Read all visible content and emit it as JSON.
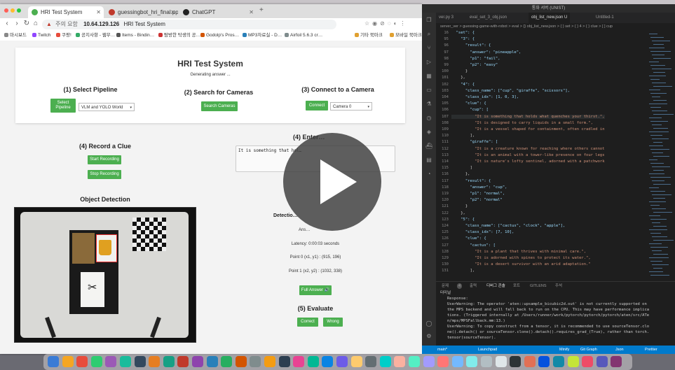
{
  "browser": {
    "tabs": [
      {
        "label": "HRI Test System",
        "color": "#4caf50"
      },
      {
        "label": "guessingbot_hri_final.pptx",
        "color": "#c0392b"
      },
      {
        "label": "ChatGPT",
        "color": "#222222"
      }
    ],
    "address": {
      "warn": "주의 요함",
      "url": "10.64.129.126",
      "page_title": "HRI Test System"
    },
    "bookmarks": [
      "마시보드",
      "Twitch",
      "쿠팡!",
      "공지사항 - 웹무…",
      "Items - Bindin…",
      "탐방한 탁생의 공…",
      "Godolp's Pros…",
      "MP3자료실 - D…",
      "Airfoil 5.6.3 cr…",
      "기타 북마크",
      "모바일 북마크"
    ]
  },
  "app": {
    "title": "HRI Test System",
    "status": "Generating answer ...",
    "pipeline": {
      "heading": "(1) Select Pipeline",
      "button": "Select Pipeline",
      "selected": "VLM and YOLO World"
    },
    "search": {
      "heading": "(2) Search for Cameras",
      "button": "Search Cameras"
    },
    "connect": {
      "heading": "(3) Connect to a Camera",
      "button": "Connect",
      "selected": "Camera 0"
    },
    "record": {
      "heading": "(4) Record a Clue",
      "start": "Start Recording",
      "stop": "Stop Recording"
    },
    "enter": {
      "heading": "(4) Enter…",
      "clue_text": "It is something that hol…"
    },
    "detection": {
      "heading": "Object Detection",
      "results_heading": "Detectio…",
      "answer_line": "Ans…",
      "latency": "Latency: 0:00:03 seconds",
      "point0": "Point 0 (x1, y1) : (915, 196)",
      "point1": "Point 1 (x2, y2) : (1032, 338)"
    },
    "full_answer": "Full Answer 🔊",
    "evaluate": {
      "heading": "(5) Evaluate",
      "correct": "Correct",
      "wrong": "Wrong"
    }
  },
  "vscode": {
    "title": "통화 서버 (UNIST)",
    "tabs": [
      "ver.py 3",
      "eval_set_3_obj.json",
      "obj_list_new.json U",
      "Untitled-1"
    ],
    "breadcrumb": "server_ver > guessing-game-with-robot > eval > {} obj_list_new.json > { } set > { } 4 > { } clue > [ ] cup",
    "lines": [
      {
        "n": "16",
        "t": "  \"set\": {"
      },
      {
        "n": "95",
        "t": "    \"3\": {"
      },
      {
        "n": "96",
        "t": "      \"result\": {"
      },
      {
        "n": "97",
        "t": "        \"answer\": \"pineapple\","
      },
      {
        "n": "98",
        "t": "        \"p1\": \"fail\","
      },
      {
        "n": "99",
        "t": "        \"p2\": \"easy\""
      },
      {
        "n": "100",
        "t": "      }"
      },
      {
        "n": "101",
        "t": "    },"
      },
      {
        "n": "102",
        "t": "    \"4\": {"
      },
      {
        "n": "103",
        "t": "      \"class_name\": [\"cup\", \"giraffe\", \"scissors\"],"
      },
      {
        "n": "104",
        "t": "      \"class_idx\": [1, 0, 3],"
      },
      {
        "n": "105",
        "t": "      \"clue\": {"
      },
      {
        "n": "106",
        "t": "        \"cup\": ["
      },
      {
        "n": "107",
        "t": "          \"It is something that holds what quenches your thirst.\","
      },
      {
        "n": "108",
        "t": "          \"It is designed to carry liquids in a small form.\","
      },
      {
        "n": "109",
        "t": "          \"It is a vessel shaped for containment, often cradled in"
      },
      {
        "n": "110",
        "t": "        ],"
      },
      {
        "n": "111",
        "t": "        \"giraffe\": ["
      },
      {
        "n": "112",
        "t": "          \"It is a creature known for reaching where others cannot"
      },
      {
        "n": "113",
        "t": "          \"It is an animal with a tower-like presence on four legs"
      },
      {
        "n": "114",
        "t": "          \"It is nature's lofty sentinel, adorned with a patchwork"
      },
      {
        "n": "115",
        "t": "        ]"
      },
      {
        "n": "116",
        "t": "      },"
      },
      {
        "n": "117",
        "t": "      \"result\": {"
      },
      {
        "n": "118",
        "t": "        \"answer\": \"cup\","
      },
      {
        "n": "119",
        "t": "        \"p1\": \"normal\","
      },
      {
        "n": "120",
        "t": "        \"p2\": \"normal\""
      },
      {
        "n": "121",
        "t": "      }"
      },
      {
        "n": "122",
        "t": "    },"
      },
      {
        "n": "123",
        "t": "    \"5\": {"
      },
      {
        "n": "124",
        "t": "      \"class_name\": [\"cactus\", \"clock\", \"apple\"],"
      },
      {
        "n": "125",
        "t": "      \"class_idx\": [7, 10],"
      },
      {
        "n": "126",
        "t": "      \"clue\": {"
      },
      {
        "n": "127",
        "t": "        \"cactus\": ["
      },
      {
        "n": "128",
        "t": "          \"It is a plant that thrives with minimal care.\","
      },
      {
        "n": "129",
        "t": "          \"It is adorned with spines to protect its water.\","
      },
      {
        "n": "130",
        "t": "          \"It is a desert survivor with an arid adaptation.\""
      },
      {
        "n": "131",
        "t": "        ],"
      }
    ],
    "panel_tabs": [
      "문제",
      "4",
      "출력",
      "디버그 콘솔",
      "포트",
      "GITLENS",
      "주석"
    ],
    "terminal_title": "터미널",
    "terminal": [
      "Response:",
      "UserWarning: The operator 'aten::upsample_bicubic2d.out' is not currently supported on",
      "the MPS backend and will fall back to run on the CPU. This may have performance implica",
      "tions. (Triggered internally at /Users/runner/work/pytorch/pytorch/pytorch/aten/src/ATe",
      "n/mps/MPSFallback.mm:13.)",
      "UserWarning: To copy construct from a tensor, it is recommended to use sourceTensor.clo",
      "ne().detach() or sourceTensor.clone().detach().requires_grad_(True), rather than torch.",
      "tensor(sourceTensor)."
    ],
    "status": {
      "branch": "main*",
      "launchpad": "Launchpad",
      "minify": "Minify",
      "git": "Git Graph",
      "lang": "Json",
      "prettier": "Prettier"
    }
  },
  "colors": {
    "green": "#4caf50",
    "vscode_blue": "#007acc",
    "overlay": "#3c3c3c"
  }
}
